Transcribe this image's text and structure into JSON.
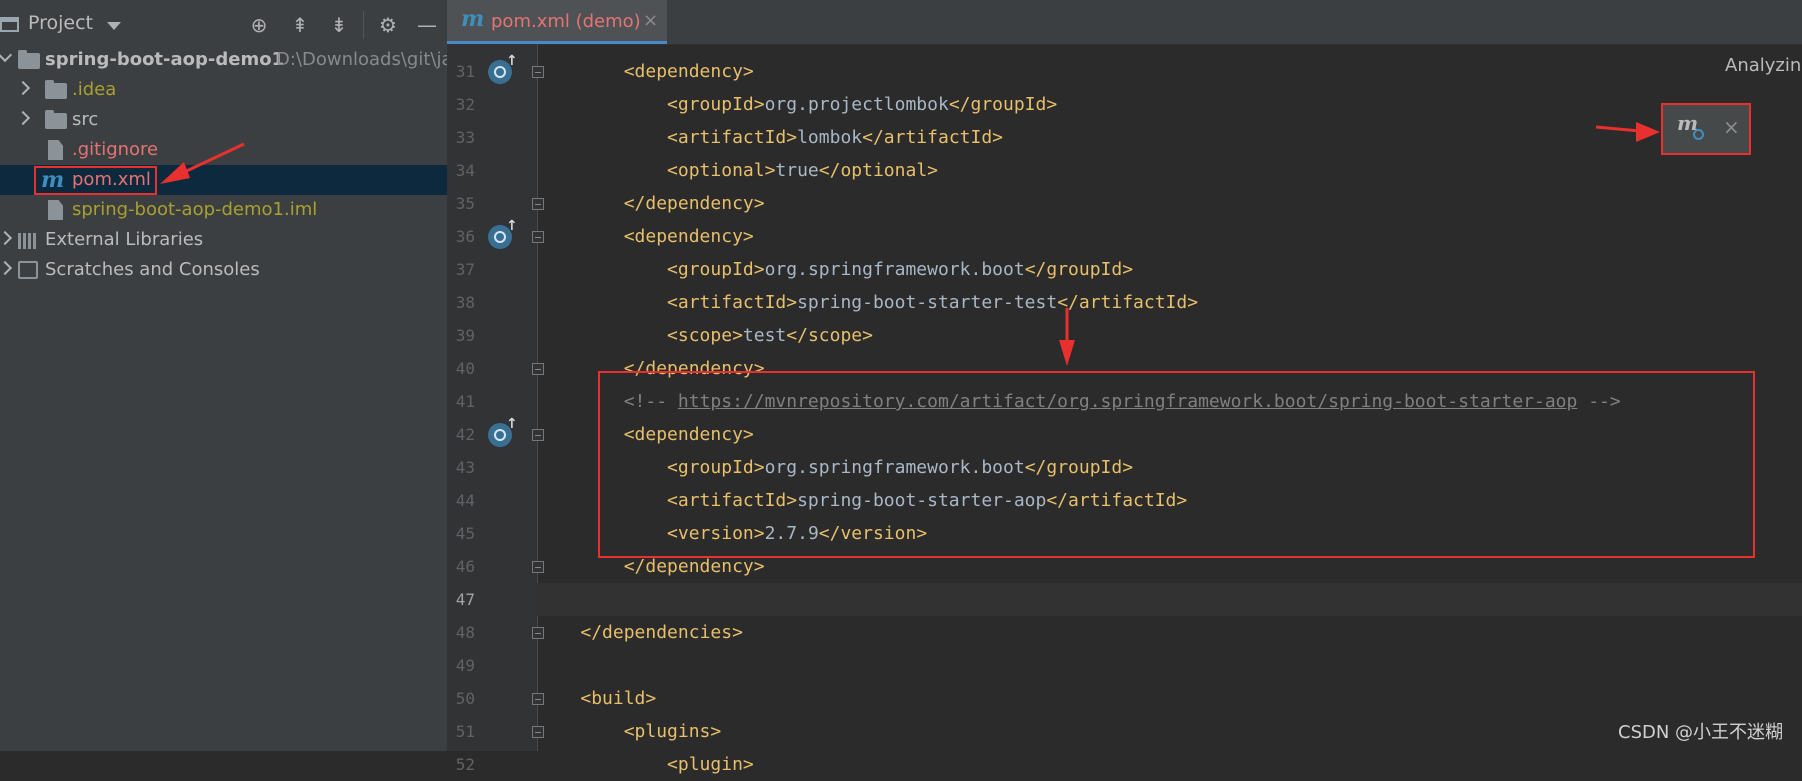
{
  "panel": {
    "title": "Project",
    "toolbar_icons": [
      "locate-icon",
      "expand-all-icon",
      "collapse-all-icon",
      "gear-icon",
      "minimize-icon"
    ]
  },
  "tree": {
    "root_name": "spring-boot-aop-demo1",
    "root_path": "D:\\Downloads\\git\\ja",
    "idea": ".idea",
    "src": "src",
    "gitignore": ".gitignore",
    "pom": "pom.xml",
    "iml": "spring-boot-aop-demo1.iml",
    "external_libraries": "External Libraries",
    "scratches": "Scratches and Consoles"
  },
  "editor": {
    "tab_label": "pom.xml (demo)",
    "tab_close": "×",
    "status": "Analyzing",
    "float_close": "×",
    "lines": [
      {
        "n": "31",
        "text": "        <dependency>"
      },
      {
        "n": "32",
        "text": "            <groupId>org.projectlombok</groupId>"
      },
      {
        "n": "33",
        "text": "            <artifactId>lombok</artifactId>"
      },
      {
        "n": "34",
        "text": "            <optional>true</optional>"
      },
      {
        "n": "35",
        "text": "        </dependency>"
      },
      {
        "n": "36",
        "text": "        <dependency>"
      },
      {
        "n": "37",
        "text": "            <groupId>org.springframework.boot</groupId>"
      },
      {
        "n": "38",
        "text": "            <artifactId>spring-boot-starter-test</artifactId>"
      },
      {
        "n": "39",
        "text": "            <scope>test</scope>"
      },
      {
        "n": "40",
        "text": "        </dependency>"
      },
      {
        "n": "41",
        "text": "        <!-- https://mvnrepository.com/artifact/org.springframework.boot/spring-boot-starter-aop -->"
      },
      {
        "n": "42",
        "text": "        <dependency>"
      },
      {
        "n": "43",
        "text": "            <groupId>org.springframework.boot</groupId>"
      },
      {
        "n": "44",
        "text": "            <artifactId>spring-boot-starter-aop</artifactId>"
      },
      {
        "n": "45",
        "text": "            <version>2.7.9</version>"
      },
      {
        "n": "46",
        "text": "        </dependency>"
      },
      {
        "n": "47",
        "text": ""
      },
      {
        "n": "48",
        "text": "    </dependencies>"
      },
      {
        "n": "49",
        "text": ""
      },
      {
        "n": "50",
        "text": "    <build>"
      },
      {
        "n": "51",
        "text": "        <plugins>"
      },
      {
        "n": "52",
        "text": "            <plugin>"
      }
    ]
  },
  "watermark": "CSDN @小王不迷糊",
  "colors": {
    "annotation_red": "#e8312f",
    "xml_tag": "#e8bf6a",
    "vcs_modified_red": "#e57373",
    "vcs_added_olive": "#a9a030"
  }
}
